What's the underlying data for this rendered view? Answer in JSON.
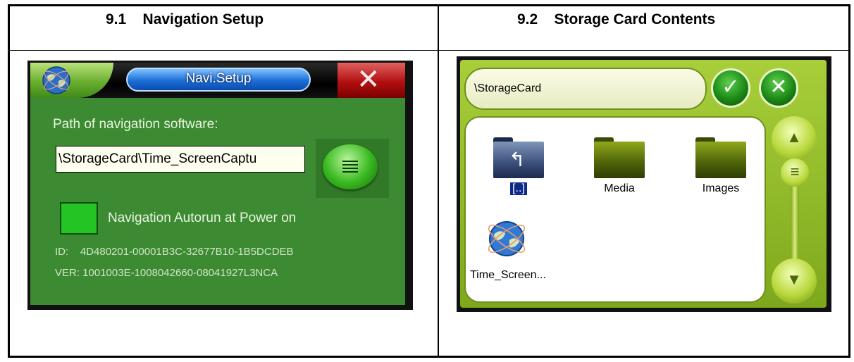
{
  "sections": {
    "left_title": "9.1    Navigation Setup",
    "right_title": "9.2    Storage Card Contents"
  },
  "navi_setup": {
    "title": "Navi.Setup",
    "close_glyph": "✕",
    "path_label": "Path of navigation software:",
    "path_value": "\\StorageCard\\Time_ScreenCaptu",
    "autorun_label": "Navigation Autorun at Power on",
    "autorun_checked": true,
    "id_line": "ID:    4D480201-00001B3C-32677B10-1B5DCDEB",
    "ver_line": "VER: 1001003E-1008042660-08041927L3NCA",
    "colors": {
      "background": "#3c8a31",
      "title_pill": "#1c6fd6",
      "close": "#b21010",
      "checkbox": "#23c423"
    }
  },
  "storage_card": {
    "path": "\\StorageCard",
    "ok_glyph": "✓",
    "cancel_glyph": "✕",
    "items": [
      {
        "label": "[..]",
        "icon": "folder-up-icon",
        "selected": true
      },
      {
        "label": "Media",
        "icon": "folder-icon",
        "selected": false
      },
      {
        "label": "Images",
        "icon": "folder-icon",
        "selected": false
      },
      {
        "label": "Time_Screen...",
        "icon": "globe-app-icon",
        "selected": false
      }
    ],
    "scroll_up_glyph": "▲",
    "scroll_down_glyph": "▼",
    "scroll_thumb_glyph": "≡",
    "colors": {
      "frame": "#a8cf3a",
      "buttons": "#1c8a16"
    }
  }
}
